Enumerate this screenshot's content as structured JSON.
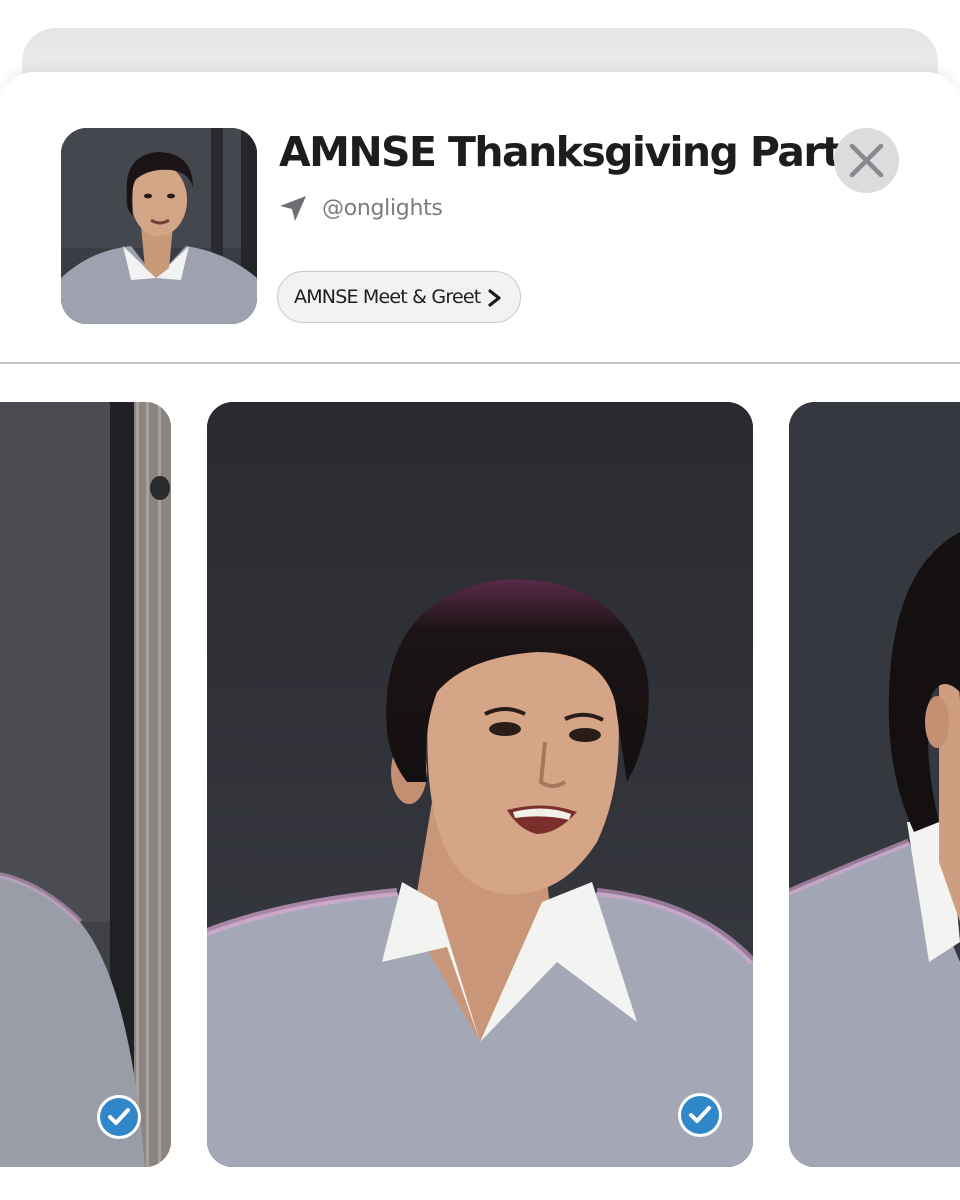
{
  "event": {
    "title": "AMNSE Thanksgiving Party",
    "handle": "@onglights",
    "album_chip_label": "AMNSE Meet & Greet"
  },
  "icons": {
    "handle_icon": "send-arrow-icon",
    "chip_icon": "chevron-right-icon",
    "close_icon": "close-x-icon",
    "selected_icon": "checkmark-icon"
  },
  "colors": {
    "title": "#1d1d1f",
    "handle": "#7c7c80",
    "chip_bg": "#f2f2f3",
    "close_bg": "#dcdcde",
    "check_accent": "#2f86c8",
    "divider": "#c8c8cc"
  },
  "photos": [
    {
      "name": "photo-left",
      "selected": true
    },
    {
      "name": "photo-center",
      "selected": true
    },
    {
      "name": "photo-right",
      "selected": false
    }
  ]
}
